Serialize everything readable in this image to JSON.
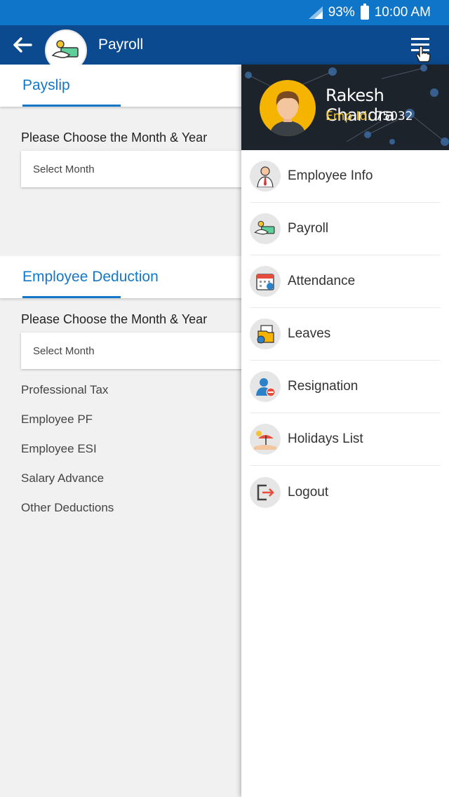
{
  "status_bar": {
    "battery": "93%",
    "time": "10:00 AM"
  },
  "app_bar": {
    "title": "Payroll"
  },
  "payslip": {
    "tab_label": "Payslip",
    "prompt": "Please Choose the Month & Year",
    "select_placeholder": "Select Month"
  },
  "deduction": {
    "tab_label": "Employee Deduction",
    "prompt": "Please Choose the Month & Year",
    "select_placeholder": "Select Month",
    "items": [
      "Professional Tax",
      "Employee PF",
      "Employee ESI",
      "Salary Advance",
      "Other Deductions"
    ]
  },
  "drawer": {
    "user_name": "Rakesh Chandra",
    "emp_id_label": "Emp Id:",
    "emp_id_value": "75032",
    "items": [
      {
        "label": "Employee Info",
        "icon": "employee-icon"
      },
      {
        "label": "Payroll",
        "icon": "payroll-icon"
      },
      {
        "label": "Attendance",
        "icon": "calendar-icon"
      },
      {
        "label": "Leaves",
        "icon": "leaves-icon"
      },
      {
        "label": "Resignation",
        "icon": "resignation-icon"
      },
      {
        "label": "Holidays List",
        "icon": "beach-icon"
      },
      {
        "label": "Logout",
        "icon": "logout-icon"
      }
    ]
  },
  "colors": {
    "status_bar": "#0f75c8",
    "app_bar": "#0c4a8f",
    "accent": "#1577c8",
    "emp_id": "#f4c430"
  }
}
